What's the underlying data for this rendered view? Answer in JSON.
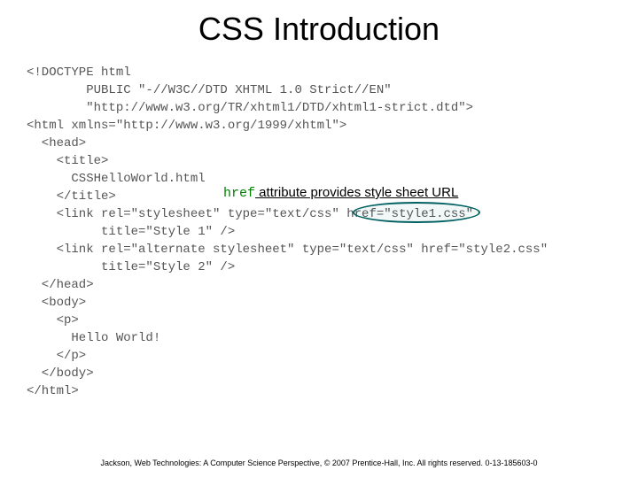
{
  "title": "CSS Introduction",
  "annot_kw": "href",
  "annot_txt": " attribute provides style sheet URL",
  "code": "<!DOCTYPE html\n        PUBLIC \"-//W3C//DTD XHTML 1.0 Strict//EN\"\n        \"http://www.w3.org/TR/xhtml1/DTD/xhtml1-strict.dtd\">\n<html xmlns=\"http://www.w3.org/1999/xhtml\">\n  <head>\n    <title>\n      CSSHelloWorld.html\n    </title>\n    <link rel=\"stylesheet\" type=\"text/css\" href=\"style1.css\"\n          title=\"Style 1\" />\n    <link rel=\"alternate stylesheet\" type=\"text/css\" href=\"style2.css\"\n          title=\"Style 2\" />\n  </head>\n  <body>\n    <p>\n      Hello World!\n    </p>\n  </body>\n</html>",
  "footer": "Jackson, Web Technologies: A Computer Science Perspective, © 2007 Prentice-Hall, Inc. All rights reserved. 0-13-185603-0"
}
